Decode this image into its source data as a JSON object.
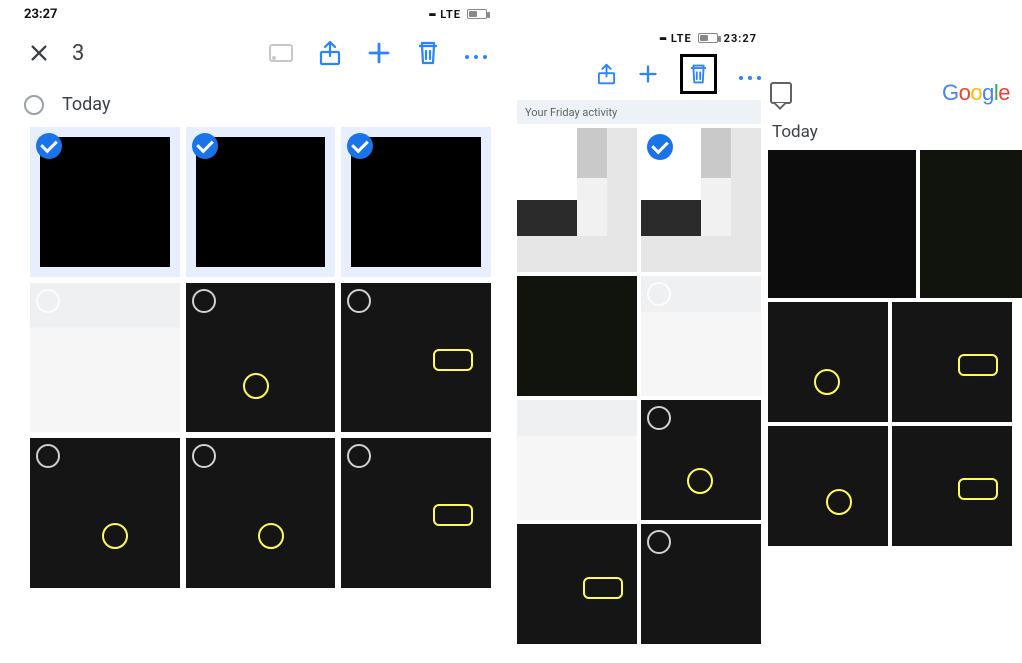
{
  "phone1": {
    "status": {
      "time": "23:27",
      "network": "LTE"
    },
    "selection": {
      "count": "3"
    },
    "section_label": "Today",
    "thumbs": [
      {
        "kind": "app-grid",
        "selected": true
      },
      {
        "kind": "black",
        "selected": true
      },
      {
        "kind": "dark-green",
        "selected": true
      },
      {
        "kind": "album-ui",
        "selected": false
      },
      {
        "kind": "album-ui",
        "selected": false
      },
      {
        "kind": "album-ui",
        "selected": false
      },
      {
        "kind": "dark-menu",
        "selected": false
      },
      {
        "kind": "dark-menu",
        "selected": false
      },
      {
        "kind": "dark-menu",
        "selected": false
      }
    ]
  },
  "phone2": {
    "status": {
      "time": "23:27",
      "network": "LTE"
    },
    "strip_label": "Your Friday activity",
    "thumbs": [
      {
        "kind": "app-grid",
        "selected": false
      },
      {
        "kind": "app-grid",
        "selected": true
      },
      {
        "kind": "dark-green",
        "selected": false
      },
      {
        "kind": "album-ui",
        "selected": false
      },
      {
        "kind": "album-ui",
        "selected": false
      },
      {
        "kind": "dark-menu",
        "selected": false
      },
      {
        "kind": "dark-menu",
        "selected": false
      },
      {
        "kind": "dark-menu",
        "selected": false
      }
    ]
  },
  "phone3": {
    "logo": "Google",
    "section_label": "Today",
    "thumbs": [
      {
        "kind": "black"
      },
      {
        "kind": "dark-green"
      },
      {
        "kind": "album-ui"
      },
      {
        "kind": "album-ui"
      },
      {
        "kind": "dark-menu"
      },
      {
        "kind": "dark-menu"
      }
    ]
  }
}
